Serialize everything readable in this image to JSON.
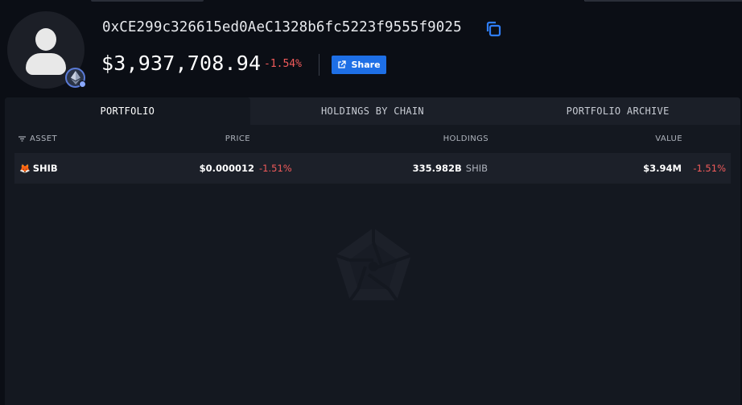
{
  "profile": {
    "address": "0xCE299c326615ed0AeC1328b6fc5223f9555f9025",
    "balance": "$3,937,708.94",
    "balance_change": "-1.54%",
    "share_label": "Share",
    "avatar_icon": "default-user-avatar",
    "chain_badge_icon": "ethereum-icon"
  },
  "tabs": [
    {
      "label": "PORTFOLIO",
      "active": true
    },
    {
      "label": "HOLDINGS BY CHAIN",
      "active": false
    },
    {
      "label": "PORTFOLIO ARCHIVE",
      "active": false
    }
  ],
  "table": {
    "columns": {
      "asset": "ASSET",
      "price": "PRICE",
      "holdings": "HOLDINGS",
      "value": "VALUE"
    },
    "rows": [
      {
        "icon": "shib-token-icon",
        "asset": "SHIB",
        "price": "$0.000012",
        "price_change": "-1.51%",
        "holdings": "335.982B",
        "holdings_symbol": "SHIB",
        "value": "$3.94M",
        "value_change": "-1.51%"
      }
    ]
  },
  "colors": {
    "background": "#0b0e15",
    "panel": "#141820",
    "accent": "#1e6fe6",
    "negative": "#f25b5b"
  }
}
